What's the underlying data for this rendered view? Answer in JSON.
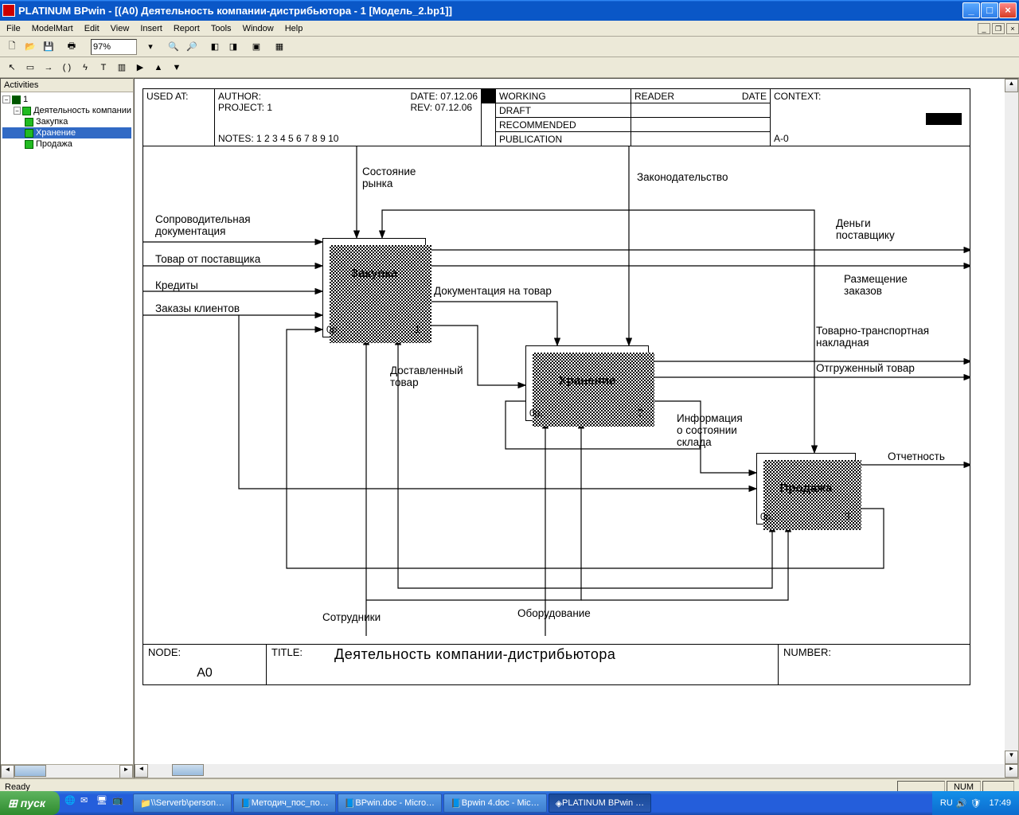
{
  "titlebar": {
    "text": "PLATINUM BPwin - [(A0) Деятельность  компании-дистрибьютора - 1  [Модель_2.bp1]]"
  },
  "menu": {
    "file": "File",
    "modelmart": "ModelMart",
    "edit": "Edit",
    "view": "View",
    "insert": "Insert",
    "report": "Report",
    "tools": "Tools",
    "window": "Window",
    "help": "Help"
  },
  "toolbar": {
    "zoom": "97%"
  },
  "sidebar": {
    "title": "Activities",
    "items": [
      {
        "label": "1"
      },
      {
        "label": "Деятельность компании"
      },
      {
        "label": "Закупка"
      },
      {
        "label": "Хранение"
      },
      {
        "label": "Продажа"
      }
    ]
  },
  "header": {
    "used_at": "USED AT:",
    "author": "AUTHOR:",
    "project": "PROJECT:  1",
    "date": "DATE: 07.12.06",
    "rev": "REV:   07.12.06",
    "notes": "NOTES:  1  2  3  4  5  6  7  8  9  10",
    "working": "WORKING",
    "draft": "DRAFT",
    "recommended": "RECOMMENDED",
    "publication": "PUBLICATION",
    "reader": "READER",
    "rdate": "DATE",
    "context": "CONTEXT:",
    "a0": "A-0"
  },
  "boxes": {
    "b1": {
      "name": "Закупка",
      "bl": "0р.",
      "br": "1"
    },
    "b2": {
      "name": "Хранение",
      "bl": "0р.",
      "br": "2"
    },
    "b3": {
      "name": "Продажа",
      "bl": "0р.",
      "br": "3"
    }
  },
  "labels": {
    "l1": "Состояние\nрынка",
    "l2": "Законодательство",
    "l3": "Сопроводительная\nдокументация",
    "l4": "Товар от поставщика",
    "l5": "Кредиты",
    "l6": "Заказы клиентов",
    "l7": "Деньги\nпоставщику",
    "l8": "Размещение\nзаказов",
    "l9": "Документация на товар",
    "l10": "Доставленный\nтовар",
    "l11": "Товарно-транспортная\nнакладная",
    "l12": "Отгруженный товар",
    "l13": "Информация\nо состоянии\nсклада",
    "l14": "Отчетность",
    "l15": "Сотрудники",
    "l16": "Оборудование"
  },
  "footer": {
    "node_l": "NODE:",
    "node_v": "A0",
    "title_l": "TITLE:",
    "title_v": "Деятельность  компании-дистрибьютора",
    "number_l": "NUMBER:"
  },
  "status": {
    "ready": "Ready",
    "num": "NUM"
  },
  "taskbar": {
    "start": "пуск",
    "tasks": [
      "\\\\Serverb\\person…",
      "Методич_пос_по…",
      "BPwin.doc - Micro…",
      "Bpwin 4.doc - Mic…",
      "PLATINUM BPwin …"
    ],
    "lang": "RU",
    "clock": "17:49"
  }
}
